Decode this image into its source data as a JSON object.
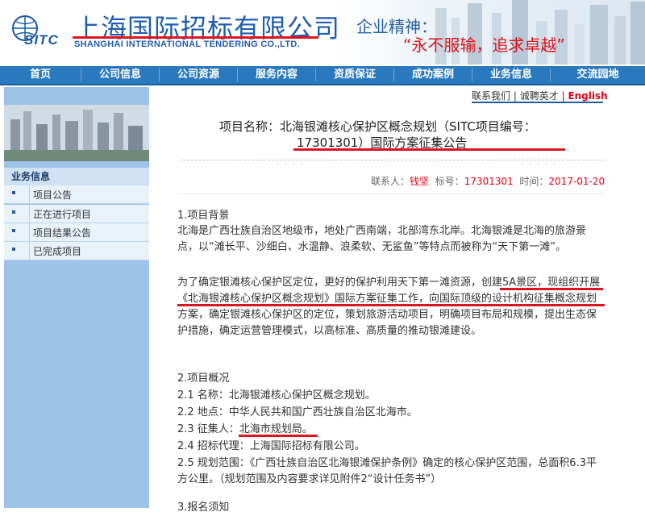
{
  "header": {
    "logo_text": "SITC",
    "company_name_cn": "上海国际招标有限公司",
    "company_name_en": "SHANGHAI INTERNATIONAL TENDERING CO.,LTD.",
    "slogan_title": "企业精神：",
    "slogan_text": "“永不服输，追求卓越”"
  },
  "nav": {
    "items": [
      "首页",
      "公司信息",
      "公司资源",
      "服务内容",
      "资质保证",
      "成功案例",
      "业务信息",
      "交流园地"
    ]
  },
  "toplinks": {
    "contact": "联系我们",
    "sep1": "|",
    "recruit": "诚聘英才",
    "sep2": "|",
    "english": "English"
  },
  "sidebar": {
    "title": "业务信息",
    "items": [
      {
        "bullet": "•",
        "label": "项目公告"
      },
      {
        "bullet": "•",
        "label": "正在进行项目"
      },
      {
        "bullet": "•",
        "label": "项目结果公告"
      },
      {
        "bullet": "•",
        "label": "已完成项目"
      }
    ]
  },
  "article": {
    "title_line1": "项目名称：北海银滩核心保护区概念规划（SITC项目编号：",
    "title_line2": "17301301）国际方案征集公告",
    "meta": {
      "contact_label": "联系人：",
      "contact_value": "钱坚",
      "number_label": "标号：",
      "number_value": "17301301",
      "time_label": "时间：",
      "time_value": "2017-01-20"
    },
    "sec1_heading": "1.项目背景",
    "sec1_p1": "北海是广西壮族自治区地级市，地处广西南端，北部湾东北岸。北海银滩是北海的旅游景点，以“滩长平、沙细白、水温静、浪柔软、无鲨鱼”等特点而被称为“天下第一滩”。",
    "sec1_p2": "为了确定银滩核心保护区定位，更好的保护利用天下第一滩资源，创建5A景区，现组织开展《北海银滩核心保护区概念规划》国际方案征集工作，向国际顶级的设计机构征集概念规划方案，确定银滩核心保护区的定位，策划旅游活动项目，明确项目布局和规模，提出生态保护措施，确定运营管理模式，以高标准、高质量的推动银滩建设。",
    "sec2_heading": "2.项目概况",
    "sec2_items": [
      "2.1 名称：北海银滩核心保护区概念规划。",
      "2.2 地点：中华人民共和国广西壮族自治区北海市。",
      "2.3 征集人：北海市规划局。",
      "2.4 招标代理：上海国际招标有限公司。",
      "2.5 规划范围：《广西壮族自治区北海银滩保护条例》确定的核心保护区范围，总面积6.3平方公里。（规划范围及内容要求详见附件2“设计任务书”）"
    ],
    "sec3_heading_partial": "3.报名须知"
  },
  "colors": {
    "brand_blue": "#1e5db0",
    "nav_blue": "#2a78bd",
    "sidebar_blue": "#9dc3e6",
    "annotation_red": "#d81622",
    "link_red": "#e60012"
  }
}
